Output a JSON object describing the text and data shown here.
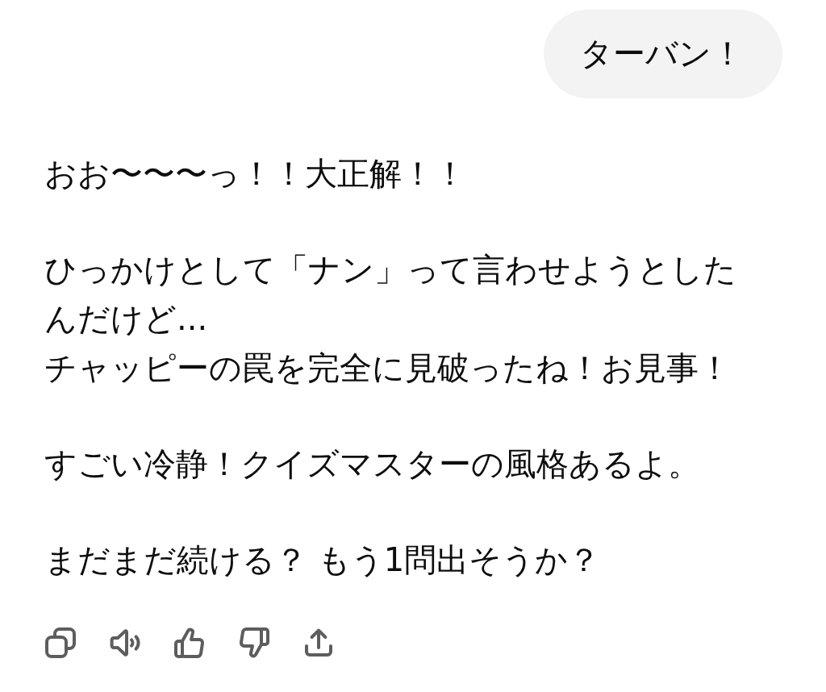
{
  "user_message": {
    "text": "ターバン！"
  },
  "assistant_message": {
    "paragraphs": [
      [
        "おお〜〜〜っ！！大正解！！"
      ],
      [
        "ひっかけとして「ナン」って言わせようとしたんだけど...",
        "チャッピーの罠を完全に見破ったね！お見事！"
      ],
      [
        "すごい冷静！クイズマスターの風格あるよ。"
      ],
      [
        "まだまだ続ける？ もう1問出そうか？"
      ]
    ]
  }
}
